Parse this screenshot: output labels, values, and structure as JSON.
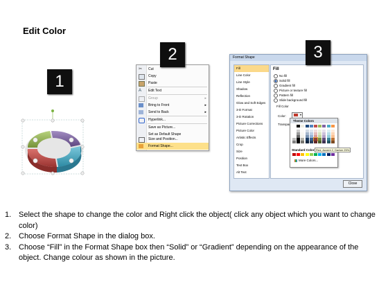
{
  "title": "Edit Color",
  "badges": [
    "1",
    "2",
    "3"
  ],
  "context_menu": {
    "items": [
      {
        "label": "Cut",
        "icon": "scissors-icon",
        "arrow": false
      },
      {
        "label": "Copy",
        "icon": "copy-icon",
        "arrow": false
      },
      {
        "label": "Paste",
        "icon": "paste-icon",
        "arrow": false
      },
      {
        "label": "Edit Text",
        "icon": "edit-text-icon",
        "arrow": false
      },
      {
        "label": "Group",
        "icon": "group-icon",
        "arrow": true
      },
      {
        "label": "Bring to Front",
        "icon": "bring-to-front-icon",
        "arrow": true
      },
      {
        "label": "Send to Back",
        "icon": "send-to-back-icon",
        "arrow": true
      },
      {
        "label": "Hyperlink...",
        "icon": "hyperlink-icon",
        "arrow": false
      },
      {
        "label": "Save as Picture...",
        "icon": "",
        "arrow": false
      },
      {
        "label": "Set as Default Shape",
        "icon": "",
        "arrow": false
      },
      {
        "label": "Size and Position...",
        "icon": "size-position-icon",
        "arrow": false
      },
      {
        "label": "Format Shape...",
        "icon": "format-shape-icon",
        "arrow": false
      }
    ],
    "highlighted": "Format Shape..."
  },
  "dialog": {
    "title": "Format Shape",
    "categories": [
      "Fill",
      "Line Color",
      "Line Style",
      "Shadow",
      "Reflection",
      "Glow and Soft Edges",
      "3-D Format",
      "3-D Rotation",
      "Picture Corrections",
      "Picture Color",
      "Artistic Effects",
      "Crop",
      "Size",
      "Position",
      "Text Box",
      "Alt Text"
    ],
    "selected_category": "Fill",
    "fill_heading": "Fill",
    "fill_options": [
      "No fill",
      "Solid fill",
      "Gradient fill",
      "Picture or texture fill",
      "Pattern fill",
      "Slide background fill"
    ],
    "selected_fill": "Solid fill",
    "fill_color_label": "Fill Color",
    "color_label": "Color:",
    "transparency_label": "Transpar",
    "close_label": "Close"
  },
  "palette": {
    "header": "Theme Colors",
    "standard_label": "Standard Colors",
    "tooltip": "Red, Accent 2, Darker 25%",
    "more_colors": "More Colors...",
    "theme_top": [
      "#ffffff",
      "#000000",
      "#eeece1",
      "#1f497d",
      "#4f81bd",
      "#c0504d",
      "#9bbb59",
      "#8064a2",
      "#4bacc6",
      "#f79646"
    ],
    "standard": [
      "#c00000",
      "#ff0000",
      "#ffc000",
      "#ffff00",
      "#92d050",
      "#00b050",
      "#00b0f0",
      "#0070c0",
      "#002060",
      "#7030a0"
    ]
  },
  "shape_colors": [
    "#c0504d",
    "#4bacc6",
    "#9bbb59",
    "#8064a2",
    "#f0b45a"
  ],
  "steps": [
    {
      "num": "1.",
      "text": "Select the shape to change the color and Right click the object( click any object which you want to change color)"
    },
    {
      "num": "2.",
      "text": "Choose Format Shape in the dialog box."
    },
    {
      "num": "3.",
      "text": "Choose “Fill” in the Format Shape box then “Solid” or “Gradient” depending on the appearance of the object. Change colour as shown in the picture."
    }
  ]
}
